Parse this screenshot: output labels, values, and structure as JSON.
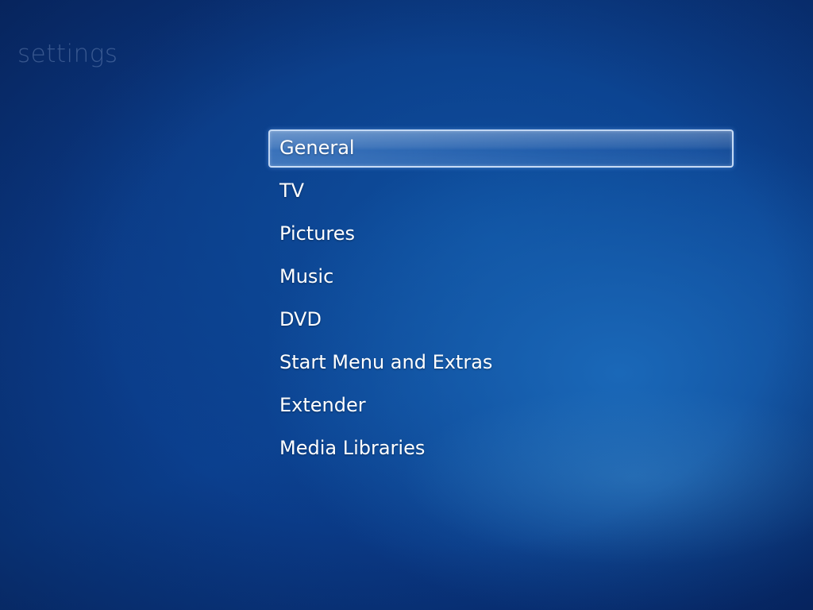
{
  "page": {
    "title": "settings"
  },
  "menu": {
    "selected_index": 0,
    "items": [
      {
        "label": "General"
      },
      {
        "label": "TV"
      },
      {
        "label": "Pictures"
      },
      {
        "label": "Music"
      },
      {
        "label": "DVD"
      },
      {
        "label": "Start Menu and Extras"
      },
      {
        "label": "Extender"
      },
      {
        "label": "Media Libraries"
      }
    ]
  },
  "colors": {
    "background_primary": "#0b3a86",
    "background_glow": "#1a68b8",
    "text": "#ffffff",
    "title_text": "#5f7cae",
    "selection_border": "#dcebff"
  }
}
